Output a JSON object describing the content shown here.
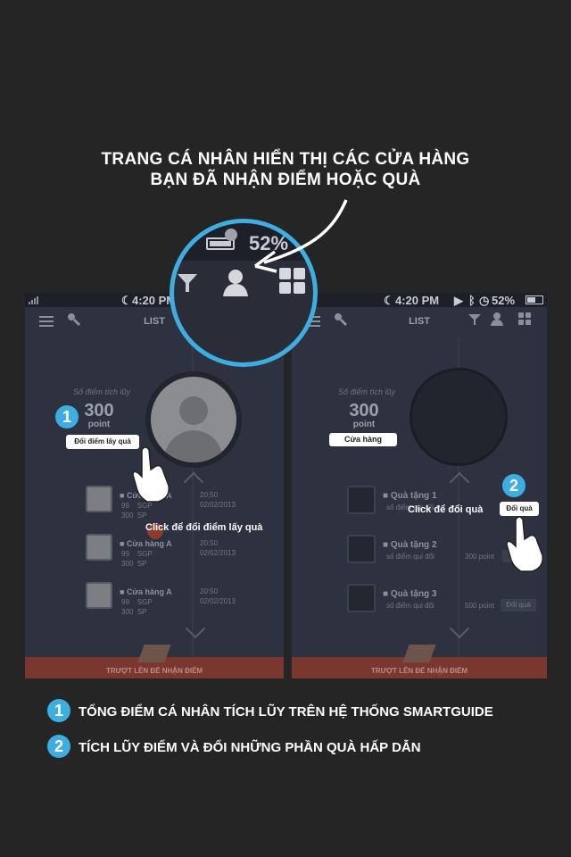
{
  "headline": {
    "line1": "TRANG CÁ NHÂN HIỂN THỊ CÁC CỬA HÀNG",
    "line2": "BẠN ĐÃ NHẬN ĐIỂM HOẶC QUÀ"
  },
  "zoom": {
    "battery_text": "52%",
    "accent_color": "#3eaee0"
  },
  "left_phone": {
    "status": {
      "time": "4:20 PM"
    },
    "nav": {
      "title": "LIST"
    },
    "points": {
      "label": "Số điểm tích lũy",
      "value": "300",
      "unit": "point"
    },
    "exchange_button": "Đổi điểm lấy quà",
    "callout": "Click để đổi điểm lấy quà",
    "rows": [
      {
        "title": "Cửa hàng A",
        "l1a": "99",
        "l1b": "SGP",
        "l2a": "300",
        "l2b": "SP",
        "d1": "20:50",
        "d2": "02/02/2013"
      },
      {
        "title": "Cửa hàng A",
        "l1a": "99",
        "l1b": "SGP",
        "l2a": "300",
        "l2b": "SP",
        "d1": "20:50",
        "d2": "02/02/2013"
      },
      {
        "title": "Cửa hàng A",
        "l1a": "99",
        "l1b": "SGP",
        "l2a": "300",
        "l2b": "SP",
        "d1": "20:50",
        "d2": "02/02/2013"
      }
    ],
    "footer": "TRƯỢT LÊN ĐỂ NHẬN ĐIỂM"
  },
  "right_phone": {
    "status": {
      "time": "4:20 PM",
      "battery": "52%"
    },
    "nav": {
      "title": "LIST"
    },
    "points": {
      "label": "Số điểm tích lũy",
      "value": "300",
      "unit": "point"
    },
    "store_button": "Cửa hàng",
    "callout": "Click để đổi quà",
    "callout_button": "Đổi quà",
    "gifts": [
      {
        "name": "Quà tặng 1",
        "sub": "số điểm qui đổi",
        "points": "",
        "btn": ""
      },
      {
        "name": "Quà tặng 2",
        "sub": "số điểm qui đổi",
        "points": "300 point",
        "btn": "Đổi"
      },
      {
        "name": "Quà tặng 3",
        "sub": "số điểm qui đổi",
        "points": "500 point",
        "btn": "Đổi quà"
      }
    ],
    "footer": "TRƯỢT LÊN ĐỂ NHẬN ĐIỂM"
  },
  "badges": {
    "one": "1",
    "two": "2"
  },
  "legend": [
    {
      "num": "1",
      "text": "TỔNG ĐIỂM CÁ NHÂN TÍCH LŨY TRÊN HỆ THỐNG SMARTGUIDE"
    },
    {
      "num": "2",
      "text": "TÍCH LŨY ĐIỂM VÀ ĐỔI NHỮNG PHẦN QUÀ HẤP DẪN"
    }
  ]
}
